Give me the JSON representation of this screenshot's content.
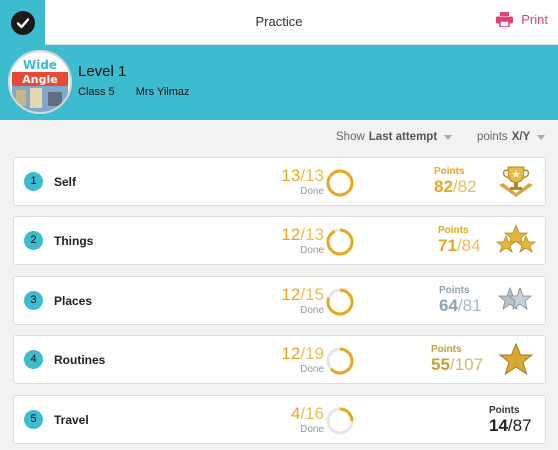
{
  "topbar": {
    "title": "Practice",
    "print_label": "Print"
  },
  "header": {
    "level": "Level 1",
    "class_name": "Class 5",
    "teacher": "Mrs Yilmaz",
    "logo_text_1": "Wide",
    "logo_text_2": "Angle"
  },
  "filters": {
    "show_label": "Show",
    "show_value": "Last attempt",
    "points_label": "points",
    "points_value": "X/Y"
  },
  "units": [
    {
      "number": "1",
      "title": "Self",
      "done_count": "13",
      "total": "13",
      "done_label": "Done",
      "progress": 1.0,
      "points_label": "Points",
      "points": "82",
      "points_total": "82",
      "badge": "trophy-icon",
      "points_color": "#e8a820"
    },
    {
      "number": "2",
      "title": "Things",
      "done_count": "12",
      "total": "13",
      "done_label": "Done",
      "progress": 0.923,
      "points_label": "Points",
      "points": "71",
      "points_total": "84",
      "badge": "three-gold-stars-icon",
      "points_color": "#e8a820"
    },
    {
      "number": "3",
      "title": "Places",
      "done_count": "12",
      "total": "15",
      "done_label": "Done",
      "progress": 0.8,
      "points_label": "Points",
      "points": "64",
      "points_total": "81",
      "badge": "silver-stars-icon",
      "points_color": "#8fa3b0"
    },
    {
      "number": "4",
      "title": "Routines",
      "done_count": "12",
      "total": "19",
      "done_label": "Done",
      "progress": 0.632,
      "points_label": "Points",
      "points": "55",
      "points_total": "107",
      "badge": "gold-star-icon",
      "points_color": "#c8a03a"
    },
    {
      "number": "5",
      "title": "Travel",
      "done_count": "4",
      "total": "16",
      "done_label": "Done",
      "progress": 0.25,
      "points_label": "Points",
      "points": "14",
      "points_total": "87",
      "badge": "",
      "points_color": "#222222"
    }
  ],
  "colors": {
    "accent": "#3dbcd0",
    "progress": "#e8a820",
    "print": "#e0407a"
  }
}
